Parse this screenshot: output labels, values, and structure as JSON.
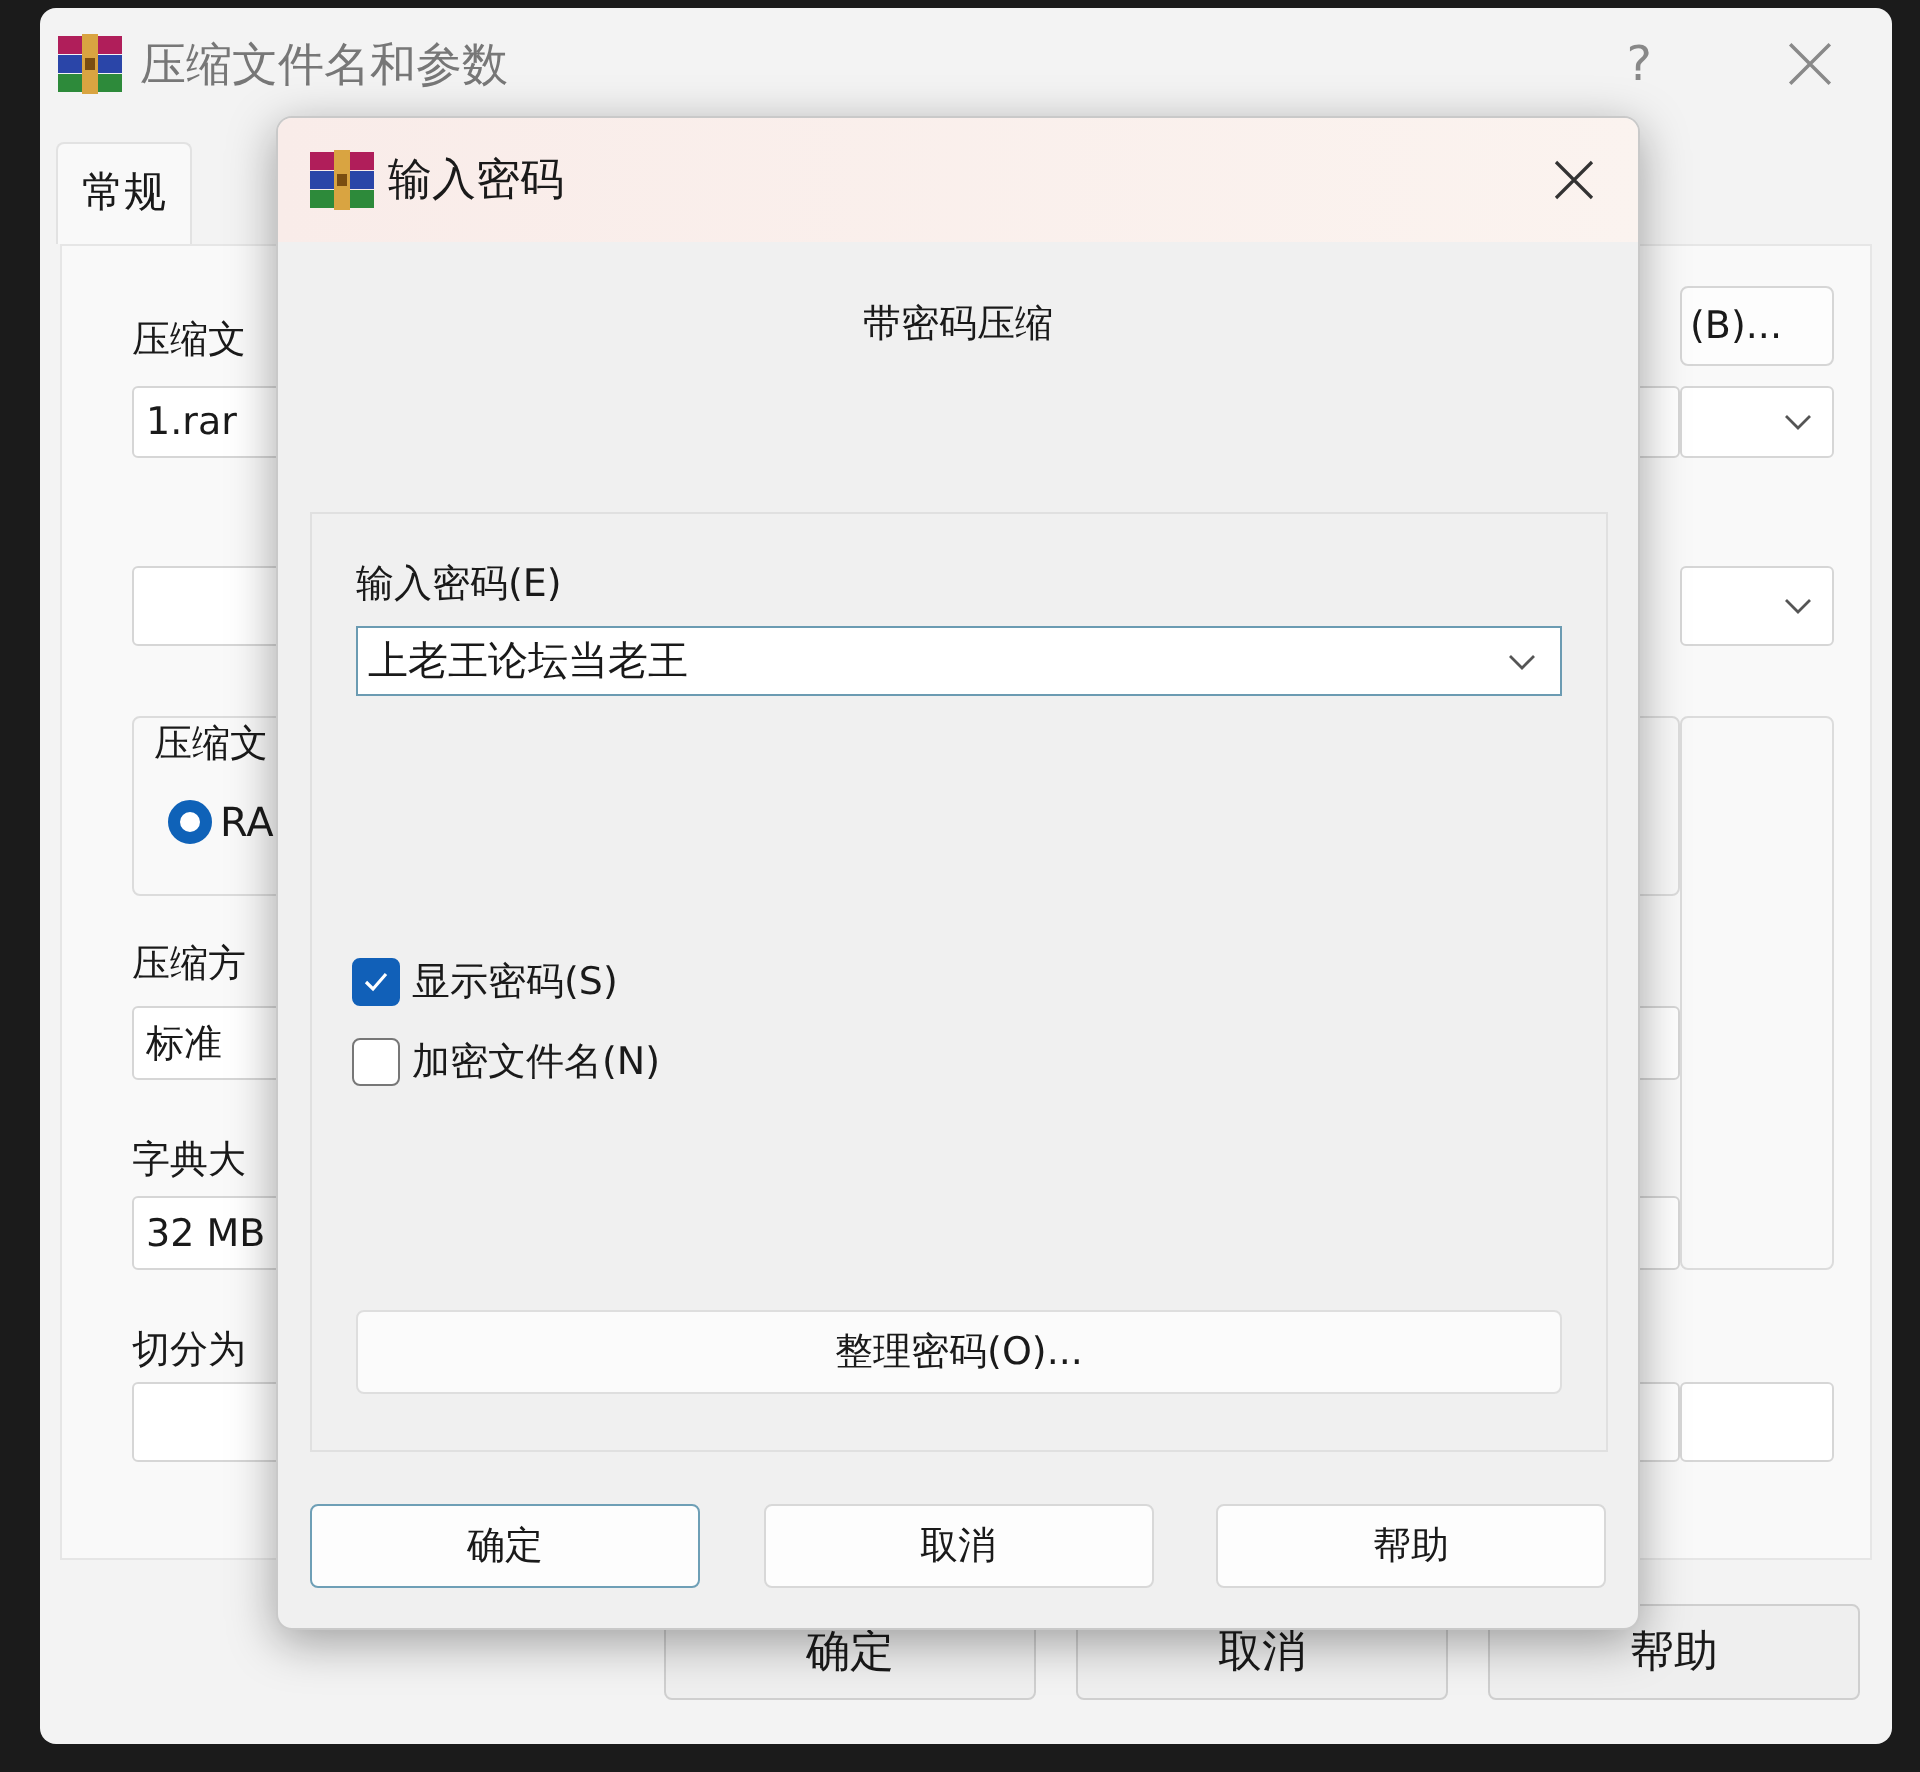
{
  "background_window": {
    "title": "压缩文件名和参数",
    "help_button": "?",
    "tabs": [
      {
        "label": "常规",
        "selected": true
      }
    ],
    "archive_name_label": "压缩文",
    "archive_name_value": "1.rar",
    "browse_button": "(B)...",
    "format_group_label": "压缩文",
    "format_radio": {
      "label": "RA",
      "selected": true
    },
    "method_label": "压缩方",
    "method_value": "标准",
    "dictionary_label": "字典大",
    "dictionary_value": "32 MB",
    "split_label": "切分为",
    "buttons": [
      {
        "label": "确定"
      },
      {
        "label": "取消"
      },
      {
        "label": "帮助"
      }
    ]
  },
  "password_dialog": {
    "title": "输入密码",
    "heading": "带密码压缩",
    "password_label": "输入密码(E)",
    "password_value": "上老王论坛当老王",
    "options": [
      {
        "label": "显示密码(S)",
        "checked": true
      },
      {
        "label": "加密文件名(N)",
        "checked": false
      }
    ],
    "organize_button": "整理密码(O)...",
    "buttons": [
      {
        "label": "确定",
        "default": true
      },
      {
        "label": "取消",
        "default": false
      },
      {
        "label": "帮助",
        "default": false
      }
    ]
  }
}
